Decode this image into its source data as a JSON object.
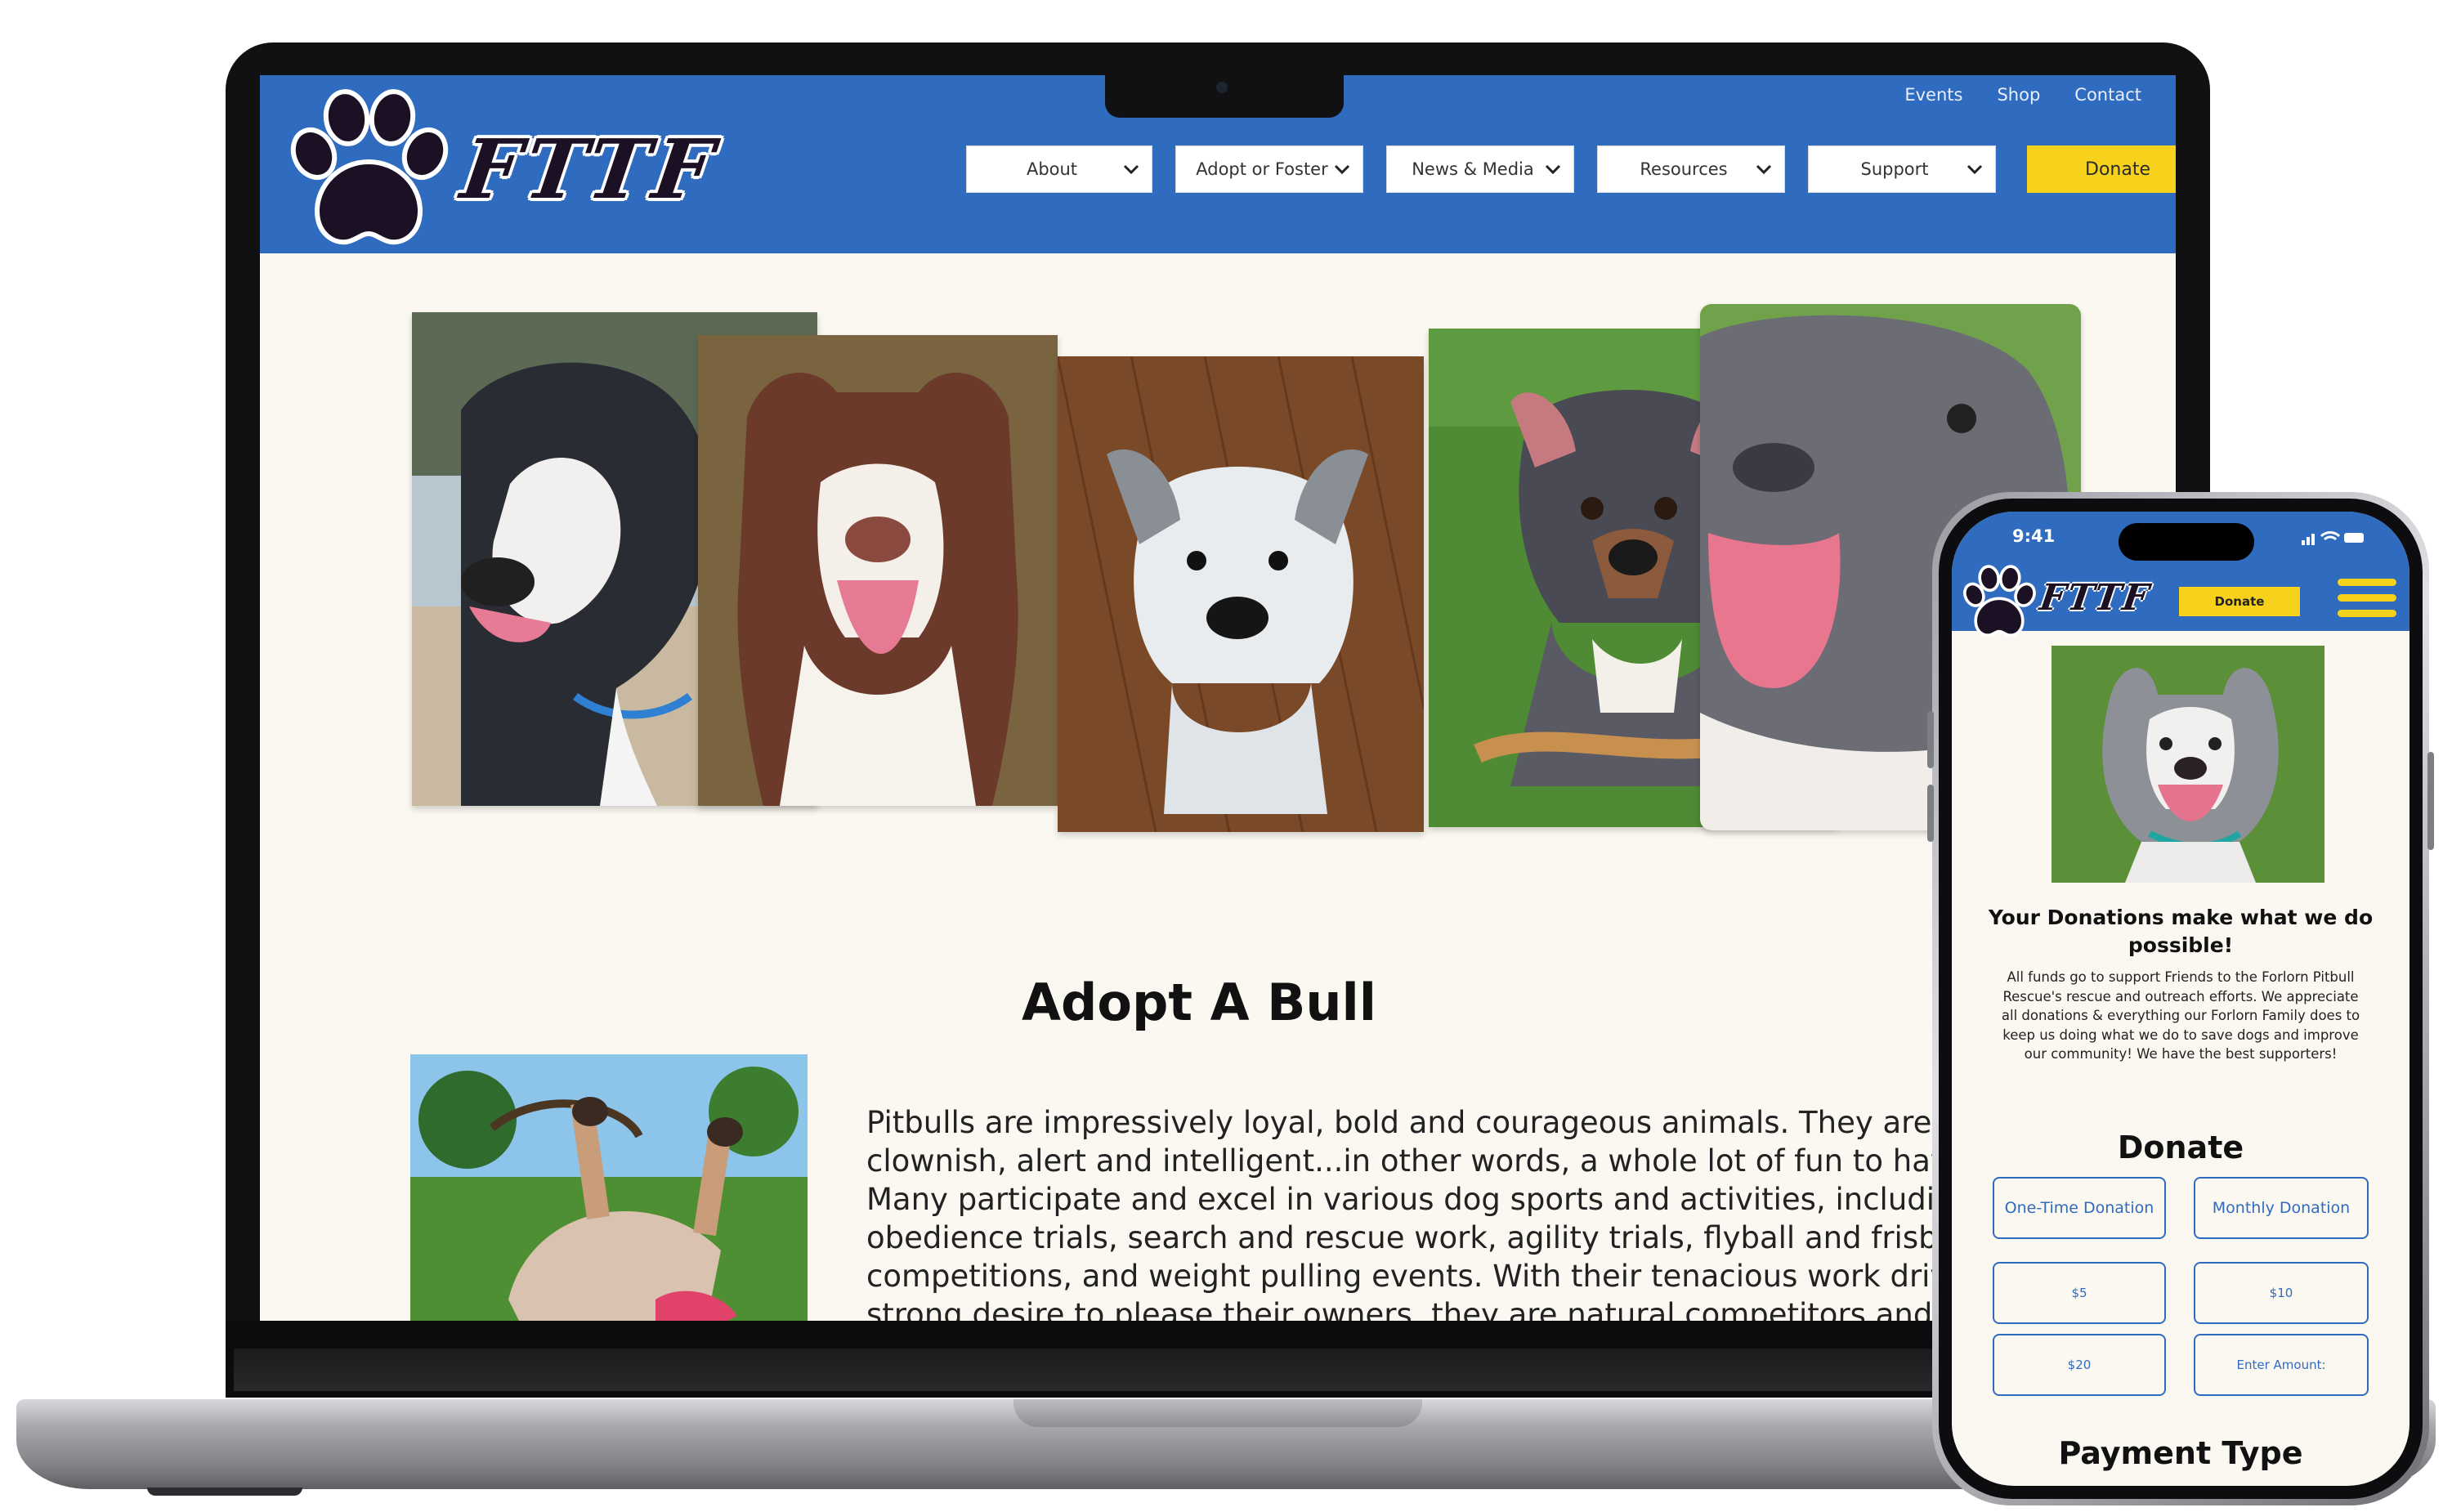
{
  "site": {
    "logo_text": "FTTF",
    "util_nav": [
      "Events",
      "Shop",
      "Contact"
    ],
    "main_nav": [
      {
        "label": "About"
      },
      {
        "label": "Adopt or Foster"
      },
      {
        "label": "News & Media"
      },
      {
        "label": "Resources"
      },
      {
        "label": "Support"
      }
    ],
    "donate_label": "Donate",
    "adopt_title": "Adopt A Bull",
    "adopt_lines": [
      "Pitbulls are impressively loyal, bold and courageous animals. They are natur",
      "clownish, alert and intelligent...in other words, a whole lot of fun to have arou",
      "Many participate and excel in various dog sports and activities, including",
      "obedience trials, search and rescue work, agility trials, flyball and frisbee",
      "competitions, and weight pulling events. With their tenacious work drive and",
      "strong desire to please their owners, they are natural competitors and win"
    ]
  },
  "mobile": {
    "time": "9:41",
    "logo_text": "FTTF",
    "donate_label": "Donate",
    "heading": "Your Donations make what we do possible!",
    "body": "All funds go to support Friends to the Forlorn Pitbull Rescue's rescue and outreach efforts. We appreciate all donations & everything our Forlorn Family does to keep us doing what we do to save dogs and improve our community! We have the best supporters!",
    "donate_title": "Donate",
    "options": {
      "one_time": "One-Time Donation",
      "monthly": "Monthly Donation",
      "amount_5": "$5",
      "amount_10": "$10",
      "amount_20": "$20",
      "enter_amount": "Enter Amount:"
    },
    "payment_title": "Payment Type"
  },
  "colors": {
    "brand_blue": "#2f6bbf",
    "accent_yellow": "#f7d21d",
    "page_bg": "#fbf8f1",
    "logo_dark": "#1c1024"
  },
  "icons": [
    "paw-logo-icon",
    "chevron-down-icon",
    "hamburger-menu-icon",
    "signal-icon",
    "wifi-icon",
    "battery-icon"
  ]
}
